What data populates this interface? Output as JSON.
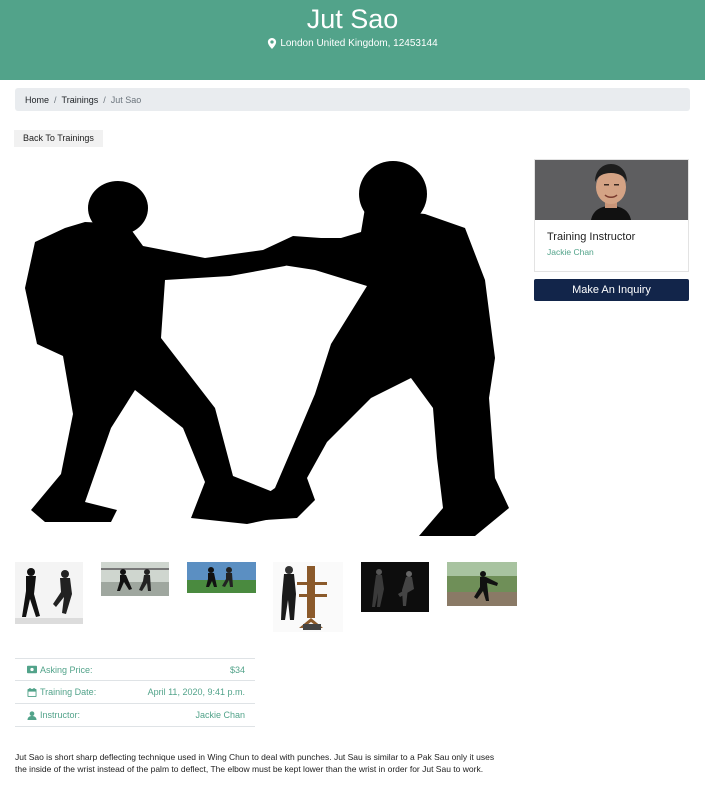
{
  "header": {
    "title": "Jut Sao",
    "location": "London United Kingdom, 12453144",
    "background_color": "#52a38a",
    "location_icon": "map-marker-icon"
  },
  "breadcrumb": {
    "items": [
      "Home",
      "Trainings"
    ],
    "current": "Jut Sao",
    "separator": "/"
  },
  "actions": {
    "back_label": "Back To Trainings",
    "inquiry_label": "Make An Inquiry",
    "inquiry_color": "#12254a"
  },
  "gallery": {
    "main_image": "silhouette-two-martial-artists",
    "thumbnails": [
      "wing-chun-sparring",
      "martial-arts-park",
      "martial-arts-outdoor",
      "wooden-dummy-training",
      "kick-training-dark",
      "kick-outdoor"
    ]
  },
  "details": {
    "price_label": "Asking Price:",
    "price_value": "$34",
    "price_icon": "money-icon",
    "date_label": "Training Date:",
    "date_value": "April 11, 2020, 9:41 p.m.",
    "date_icon": "calendar-icon",
    "instructor_label": "Instructor:",
    "instructor_value": "Jackie Chan",
    "instructor_icon": "user-icon",
    "accent_color": "#52a38a"
  },
  "description": "Jut Sao is short sharp deflecting technique used in Wing Chun to deal with punches. Jut Sau is similar to a Pak Sau only it uses the inside of the wrist instead of the palm to deflect, The elbow must be kept lower than the wrist in order for Jut Sau to work.",
  "instructor_card": {
    "title": "Training Instructor",
    "name": "Jackie Chan"
  }
}
